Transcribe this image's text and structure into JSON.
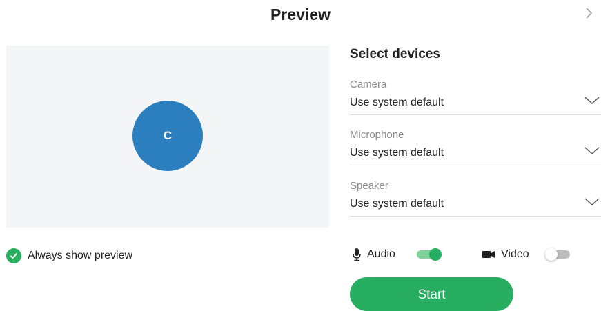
{
  "dialog": {
    "title": "Preview",
    "close_icon": "chevron-right-icon"
  },
  "preview": {
    "avatar_initial": "C",
    "avatar_color": "#2b7fbf",
    "always_show_label": "Always show preview",
    "always_show_checked": true
  },
  "devices": {
    "title": "Select devices",
    "items": [
      {
        "label": "Camera",
        "value": "Use system default"
      },
      {
        "label": "Microphone",
        "value": "Use system default"
      },
      {
        "label": "Speaker",
        "value": "Use system default"
      }
    ]
  },
  "controls": {
    "audio": {
      "label": "Audio",
      "icon": "microphone-icon",
      "enabled": true
    },
    "video": {
      "label": "Video",
      "icon": "video-camera-icon",
      "enabled": false
    },
    "start_label": "Start"
  },
  "colors": {
    "accent": "#27ae60",
    "preview_bg": "#f4f5f7",
    "avatar": "#2b7fbf"
  }
}
